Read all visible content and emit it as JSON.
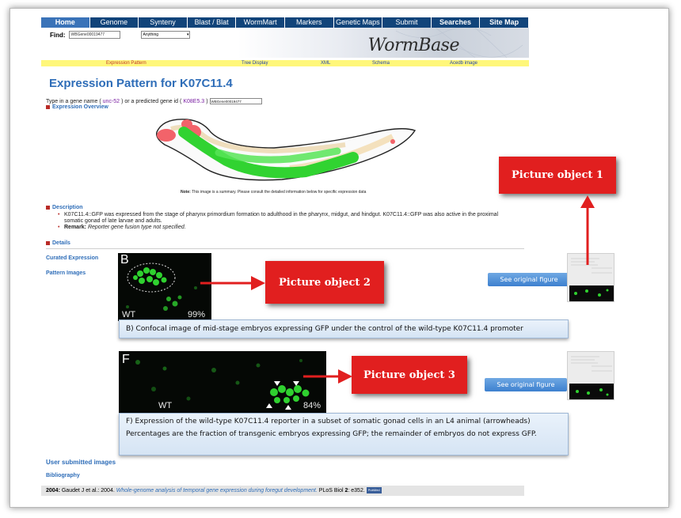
{
  "nav": [
    {
      "label": "Home",
      "active": true
    },
    {
      "label": "Genome"
    },
    {
      "label": "Synteny"
    },
    {
      "label": "Blast / Blat"
    },
    {
      "label": "WormMart"
    },
    {
      "label": "Markers"
    },
    {
      "label": "Genetic Maps"
    },
    {
      "label": "Submit"
    },
    {
      "label": "Searches",
      "bold": true
    },
    {
      "label": "Site Map",
      "bold": true
    }
  ],
  "find": {
    "label": "Find:",
    "value": "WBGene00019477",
    "select": "Anything",
    "select_arrow": "▾"
  },
  "logo": "WormBase",
  "subnav": {
    "expression_pattern": "Expression Pattern",
    "tree_display": "Tree Display",
    "xml": "XML",
    "schema": "Schema",
    "acedb_image": "Acedb image"
  },
  "title": "Expression Pattern for K07C11.4",
  "gene_search": {
    "prefix": "Type in a gene name (",
    "gene_name_example": "unc-52",
    "middle": ") or a predicted gene id (",
    "gene_id_example": "K08E5.3",
    "suffix": ")",
    "value": "WBGene00019477"
  },
  "sections": {
    "overview": "Expression Overview",
    "description": "Description",
    "details": "Details"
  },
  "overview_note": {
    "bold": "Note:",
    "text": " This image is a summary. Please consult the detailed information below for specific expression data"
  },
  "description": {
    "line1": "K07C11.4::GFP was expressed from the stage of pharynx primordium formation to adulthood in the pharynx, midgut, and hindgut. K07C11.4::GFP was also active in the proximal somatic gonad of late larvae and adults.",
    "remark_label": "Remark:",
    "remark_text": " Reporter gene fusion type not specified."
  },
  "side_links": {
    "curated": "Curated Expression",
    "pattern_images": "Pattern Images",
    "user_submitted": "User submitted images",
    "bibliography": "Bibliography"
  },
  "figure_b": {
    "letter": "B",
    "wt": "WT",
    "percent": "99%",
    "caption": "B) Confocal image of mid-stage embryos expressing GFP under the control of the wild-type K07C11.4 promoter"
  },
  "figure_f": {
    "letter": "F",
    "wt": "WT",
    "percent": "84%",
    "caption": "F) Expression of the wild-type K07C11.4 reporter in a subset of somatic gonad cells in an L4 animal (arrowheads)  Percentages are the fraction of transgenic embryos expressing GFP; the remainder of embryos do not express GFP."
  },
  "see_original": "See original figure",
  "annotations": {
    "obj1": "Picture object 1",
    "obj2": "Picture object 2",
    "obj3": "Picture object 3"
  },
  "bibliography": {
    "year": "2004:",
    "authors": " Gaudet J et al.: 2004. ",
    "title": "Whole-genome analysis of temporal gene expression during foregut development.",
    "journal": " PLoS Biol ",
    "volume": "2",
    "pages": ": e352.",
    "badge": "PubMed"
  },
  "colors": {
    "nav": "#11447a",
    "title": "#2e6db8",
    "annotation": "#e11f1f",
    "gfp": "#2fd12f"
  }
}
